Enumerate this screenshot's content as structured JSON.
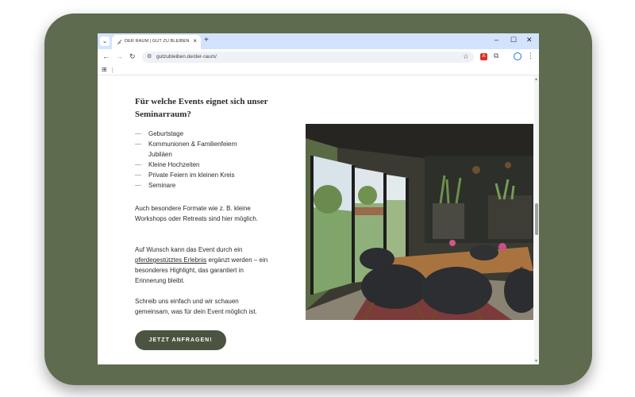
{
  "browser": {
    "tab_title": "DER RAUM | GUT ZU BLEIBEN",
    "tab_favicon": "feather-icon",
    "new_tab_icon": "+",
    "url": "gutzubleiben.de/der-raum/",
    "window_controls": [
      "–",
      "☐",
      "✕"
    ]
  },
  "content": {
    "heading": "Für welche Events eignet sich unser Seminarraum?",
    "events": [
      {
        "label": "Geburtstage"
      },
      {
        "label": "Kommunionen & Familienfeiern"
      },
      {
        "label": "Jubiläen"
      },
      {
        "label": "Kleine Hochzeiten"
      },
      {
        "label": "Private Feiern im kleinen Kreis"
      },
      {
        "label": "Seminare"
      }
    ],
    "paragraph1": "Auch besondere Formate wie z. B. kleine Workshops oder Retreats sind hier möglich.",
    "paragraph2_before": "Auf Wunsch kann das Event durch ein ",
    "paragraph2_link": "pferdegestütztes Erlebnis",
    "paragraph2_after": " ergänzt werden – ein besonderes Highlight, das garantiert in Erinnerung bleibt.",
    "paragraph3": "Schreib uns einfach und wir schauen gemeinsam, was für dein Event möglich ist.",
    "cta_label": "JETZT ANFRAGEN!"
  },
  "colors": {
    "tablet_frame": "#5f6b4f",
    "cta_background": "#4b5440",
    "tabbar": "#d3e3fd"
  },
  "icons": {
    "back": "back-arrow-icon",
    "forward": "forward-arrow-icon",
    "reload": "reload-icon",
    "site_info": "site-info-icon",
    "bookmark": "star-icon",
    "extension_pdf": "pdf-extension-icon",
    "extensions": "puzzle-icon",
    "profile": "profile-icon",
    "menu": "kebab-menu-icon",
    "apps": "apps-grid-icon",
    "back_to_top": "chevron-up-icon"
  }
}
